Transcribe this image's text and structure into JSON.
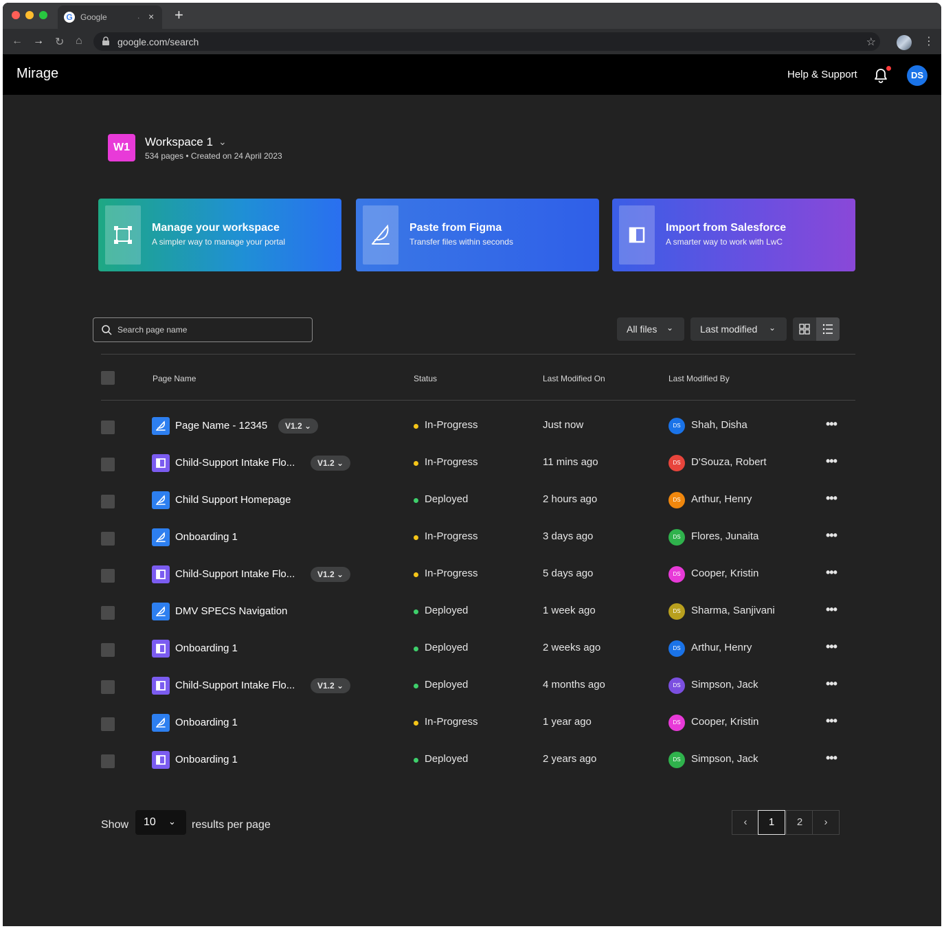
{
  "browser": {
    "tab_title": "Google",
    "tab_dot": ".",
    "tab_close": "×",
    "new_tab": "+",
    "url": "google.com/search",
    "traffic_lights": [
      "#ff5f57",
      "#febc2e",
      "#28c840"
    ]
  },
  "header": {
    "brand": "Mirage",
    "help_label": "Help & Support",
    "avatar_initials": "DS"
  },
  "workspace": {
    "badge": "W1",
    "name": "Workspace 1",
    "meta": "534 pages • Created on 24 April 2023"
  },
  "cards": [
    {
      "title": "Manage your workspace",
      "subtitle": "A simpler way to manage your portal",
      "icon": "frame-icon"
    },
    {
      "title": "Paste from Figma",
      "subtitle": "Transfer files within seconds",
      "icon": "feather-icon"
    },
    {
      "title": "Import from Salesforce",
      "subtitle": "A smarter way to work with LwC",
      "icon": "panel-icon"
    }
  ],
  "toolbar": {
    "search_placeholder": "Search page name",
    "filter_label": "All files",
    "sort_label": "Last modified",
    "view_modes": [
      "grid",
      "list"
    ],
    "active_view": "list"
  },
  "table": {
    "headers": [
      "Page Name",
      "Status",
      "Last Modified On",
      "Last Modified By"
    ],
    "rows": [
      {
        "icon": "figma",
        "name": "Page Name - 12345",
        "version": "V1.2",
        "status": "In-Progress",
        "modified_on": "Just now",
        "initials": "DS",
        "avatar_color": "#1a73e8",
        "modified_by": "Shah, Disha"
      },
      {
        "icon": "salesforce",
        "name": "Child-Support Intake Flo...",
        "version": "V1.2",
        "status": "In-Progress",
        "modified_on": "11 mins ago",
        "initials": "DS",
        "avatar_color": "#e8453c",
        "modified_by": "D'Souza, Robert"
      },
      {
        "icon": "figma",
        "name": "Child Support Homepage",
        "version": "",
        "status": "Deployed",
        "modified_on": "2 hours ago",
        "initials": "DS",
        "avatar_color": "#f0870d",
        "modified_by": "Arthur, Henry"
      },
      {
        "icon": "figma",
        "name": "Onboarding 1",
        "version": "",
        "status": "In-Progress",
        "modified_on": "3 days ago",
        "initials": "DS",
        "avatar_color": "#2fb24c",
        "modified_by": "Flores, Junaita"
      },
      {
        "icon": "salesforce",
        "name": "Child-Support Intake Flo...",
        "version": "V1.2",
        "status": "In-Progress",
        "modified_on": "5 days ago",
        "initials": "DS",
        "avatar_color": "#e83ad8",
        "modified_by": "Cooper, Kristin"
      },
      {
        "icon": "figma",
        "name": "DMV SPECS Navigation",
        "version": "",
        "status": "Deployed",
        "modified_on": "1 week ago",
        "initials": "DS",
        "avatar_color": "#b9a01e",
        "modified_by": "Sharma, Sanjivani"
      },
      {
        "icon": "salesforce",
        "name": "Onboarding 1",
        "version": "",
        "status": "Deployed",
        "modified_on": "2 weeks ago",
        "initials": "DS",
        "avatar_color": "#1a73e8",
        "modified_by": "Arthur, Henry"
      },
      {
        "icon": "salesforce",
        "name": "Child-Support Intake Flo...",
        "version": "V1.2",
        "status": "Deployed",
        "modified_on": "4 months ago",
        "initials": "DS",
        "avatar_color": "#7b4fe0",
        "modified_by": "Simpson, Jack"
      },
      {
        "icon": "figma",
        "name": "Onboarding 1",
        "version": "",
        "status": "In-Progress",
        "modified_on": "1 year ago",
        "initials": "DS",
        "avatar_color": "#e83ad8",
        "modified_by": "Cooper, Kristin"
      },
      {
        "icon": "salesforce",
        "name": "Onboarding 1",
        "version": "",
        "status": "Deployed",
        "modified_on": "2 years ago",
        "initials": "DS",
        "avatar_color": "#2fb24c",
        "modified_by": "Simpson, Jack"
      }
    ]
  },
  "pagination": {
    "show_label": "Show",
    "per_page": "10",
    "results_label": "results per page",
    "pages": [
      "1",
      "2"
    ],
    "current_page": "1"
  },
  "colors": {
    "in_progress": "#f5c518",
    "deployed": "#3ecf6b",
    "figma_icon": "#2d7ff0",
    "salesforce_icon": "#7b5cf0"
  }
}
